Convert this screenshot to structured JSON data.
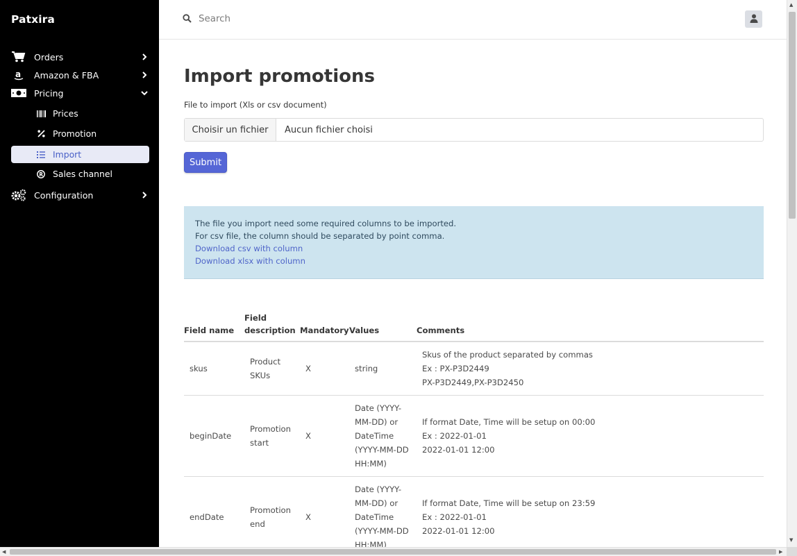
{
  "sidebar": {
    "brand": "Patxira",
    "items": [
      {
        "label": "Orders",
        "icon": "cart-icon"
      },
      {
        "label": "Amazon & FBA",
        "icon": "amazon-icon"
      },
      {
        "label": "Pricing",
        "icon": "money-icon",
        "expanded": true
      },
      {
        "label": "Configuration",
        "icon": "gears-icon"
      }
    ],
    "sub_items": [
      {
        "label": "Prices",
        "icon": "barcode-icon"
      },
      {
        "label": "Promotion",
        "icon": "percent-icon"
      },
      {
        "label": "Import",
        "icon": "list-icon",
        "active": true
      },
      {
        "label": "Sales channel",
        "icon": "registered-icon"
      }
    ]
  },
  "topbar": {
    "search_placeholder": "Search",
    "user_icon": "user-icon"
  },
  "main": {
    "title": "Import promotions",
    "file_label": "File to import (Xls or csv document)",
    "file_button": "Choisir un fichier",
    "file_name": "Aucun fichier choisi",
    "submit": "Submit",
    "info": {
      "line1": "The file you import need some required columns to be imported.",
      "line2": "For csv file, the column should be separated by point comma.",
      "link_csv": "Download csv with column",
      "link_xlsx": "Download xlsx with column"
    },
    "table": {
      "headers": [
        "Field name",
        "Field description",
        "Mandatory",
        "Values",
        "Comments"
      ],
      "rows": [
        {
          "field": "skus",
          "description": "Product SKUs",
          "mandatory": "X",
          "values": "string",
          "comments": [
            "Skus of the product separated by commas",
            "Ex : PX-P3D2449",
            "PX-P3D2449,PX-P3D2450"
          ]
        },
        {
          "field": "beginDate",
          "description": "Promotion start",
          "mandatory": "X",
          "values": "Date (YYYY-MM-DD) or DateTime (YYYY-MM-DD HH:MM)",
          "comments": [
            "If format Date, Time will be setup on 00:00",
            "Ex : 2022-01-01",
            "2022-01-01 12:00"
          ]
        },
        {
          "field": "endDate",
          "description": "Promotion end",
          "mandatory": "X",
          "values": "Date (YYYY-MM-DD) or DateTime (YYYY-MM-DD HH:MM)",
          "comments": [
            "If format Date, Time will be setup on 23:59",
            "Ex : 2022-01-01",
            "2022-01-01 12:00"
          ]
        }
      ]
    }
  },
  "colors": {
    "sidebar_bg": "#000000",
    "accent": "#5566d6",
    "info_bg": "#cde4ef",
    "active_bg": "#e8eaf6"
  }
}
